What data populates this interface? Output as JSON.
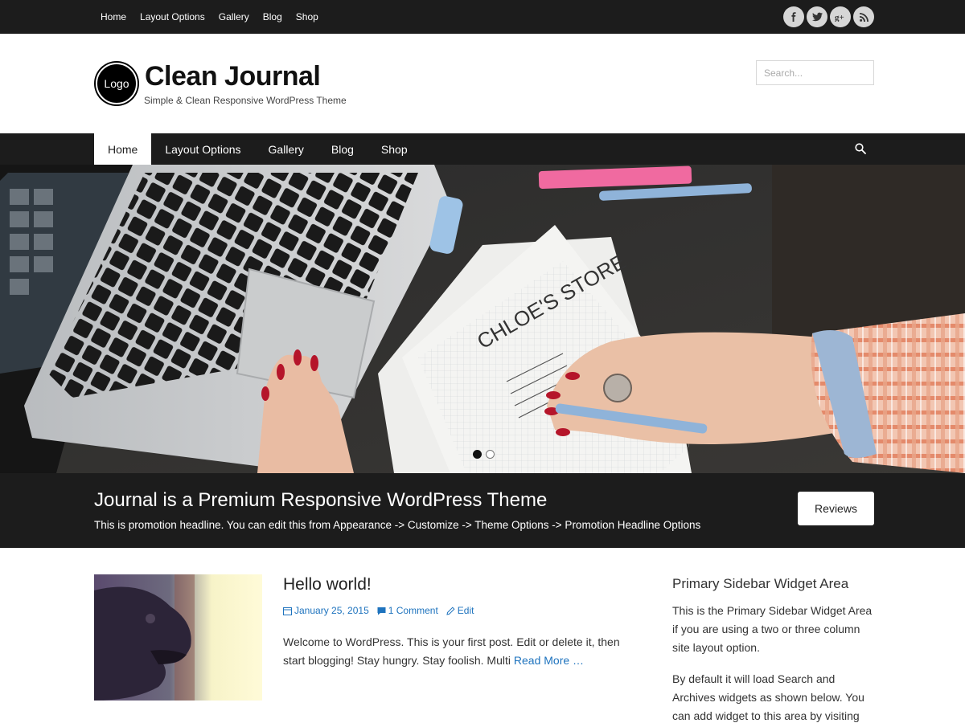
{
  "top_bar": {
    "nav": [
      "Home",
      "Layout Options",
      "Gallery",
      "Blog",
      "Shop"
    ],
    "social": [
      {
        "icon": "facebook-icon",
        "glyph": "f"
      },
      {
        "icon": "twitter-icon",
        "glyph": "t"
      },
      {
        "icon": "google-plus-icon",
        "glyph": "g+"
      },
      {
        "icon": "rss-icon",
        "glyph": "rss"
      }
    ]
  },
  "header": {
    "logo_text": "Logo",
    "site_title": "Clean Journal",
    "tagline": "Simple & Clean Responsive WordPress Theme",
    "search_placeholder": "Search..."
  },
  "main_nav": {
    "items": [
      "Home",
      "Layout Options",
      "Gallery",
      "Blog",
      "Shop"
    ],
    "active": "Home"
  },
  "slider": {
    "dots": 2,
    "active_dot": 1
  },
  "promotion": {
    "title": "Journal is a Premium Responsive WordPress Theme",
    "subtitle": "This is promotion headline. You can edit this from Appearance -> Customize -> Theme Options -> Promotion Headline Options",
    "button_label": "Reviews"
  },
  "post": {
    "title": "Hello world!",
    "date": "January 25, 2015",
    "comments": "1 Comment",
    "edit": "Edit",
    "excerpt": "Welcome to WordPress. This is your first post. Edit or delete it, then start blogging! Stay hungry. Stay foolish. Multi",
    "read_more": "Read More …"
  },
  "sidebar": {
    "title": "Primary Sidebar Widget Area",
    "text1": "This is the Primary Sidebar Widget Area if you are using a two or three column site layout option.",
    "text2": "By default it will load Search and Archives widgets as shown below. You can add widget to this area by visiting your"
  },
  "colors": {
    "bar_bg": "#1c1c1c",
    "link": "#1e73be",
    "social_bg": "#d6d6d6"
  }
}
